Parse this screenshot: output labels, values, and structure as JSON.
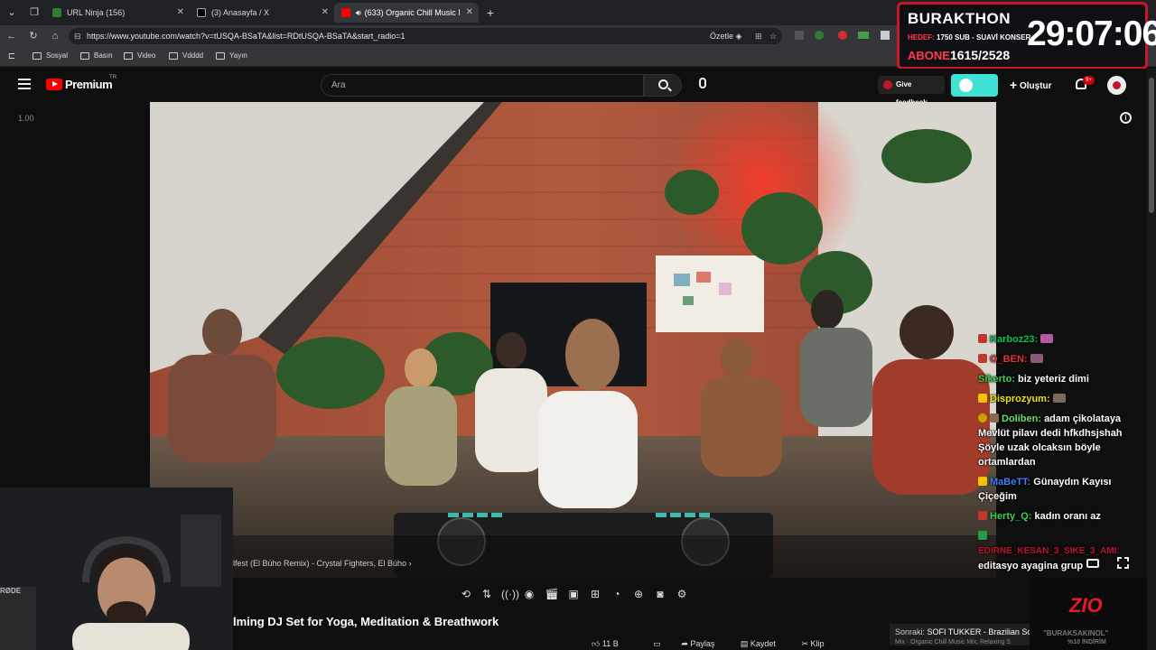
{
  "browser": {
    "tabs": [
      {
        "label": "URL Ninja (156)"
      },
      {
        "label": "(3) Anasayfa / X"
      },
      {
        "label": "(633) Organic Chill Music Mix"
      }
    ],
    "url": "https://www.youtube.com/watch?v=tUSQA-BSaTA&list=RDtUSQA-BSaTA&start_radio=1",
    "summarize_label": "Özetle",
    "bookmarks": [
      "Sosyal",
      "Basın",
      "Video",
      "Vdddd",
      "Yayın"
    ]
  },
  "overlay": {
    "title": "BURAKTHON",
    "hedef_label": "HEDEF:",
    "hedef_text": "1750 SUB - SUAVİ KONSER",
    "abone_label": "ABONE",
    "abone_value": "1615/2528",
    "timer": "29:07:06"
  },
  "youtube": {
    "logo": "Premium",
    "region": "TR",
    "search_placeholder": "Ara",
    "feedback_label": "Give feedback",
    "create_label": "Oluştur",
    "notif_badge": "9+",
    "speed_label": "1.00"
  },
  "video": {
    "song_label": "lfest (El Búho Remix) - Crystal Fighters, El Búho",
    "title": "lming DJ Set for Yoga, Meditation & Breathwork",
    "next_label": "Sonraki:",
    "next_text": "SOFI TUKKER - Brazilian So",
    "next_sub": "Mix · Organic Chill Music Mix, Relaxing S",
    "actions": [
      "11 B",
      "Paylaş",
      "Kaydet",
      "Klip"
    ]
  },
  "chat": [
    {
      "user": "Karboz23:",
      "msg": "",
      "color": "#00c853",
      "badge": "#c0392b"
    },
    {
      "user": "O_BEN:",
      "msg": "",
      "color": "#e53935",
      "badge": "#c0392b"
    },
    {
      "user": "Sikerto:",
      "msg": "biz yeteriz dimi",
      "color": "#39d353",
      "badge": ""
    },
    {
      "user": "Disprozyum:",
      "msg": "",
      "color": "#f2e600",
      "badge": "#f2c200"
    },
    {
      "user": "Doliben:",
      "msg": "adam çikolataya Mevlüt pilavı dedi hfkdhsjshah Şöyle uzak olcaksın böyle ortamlardan",
      "color": "#66e066",
      "badge": "#c7a300"
    },
    {
      "user": "MaBeTT:",
      "msg": "Günaydın Kayısı Çiçeğim",
      "color": "#3d7fff",
      "badge": "#f2c200"
    },
    {
      "user": "Herty_Q:",
      "msg": "kadın oranı az",
      "color": "#39d353",
      "badge": "#c0392b"
    },
    {
      "user": "",
      "msg": "",
      "color": "#39d353",
      "badge": "#1e9e4a"
    },
    {
      "user": "EDIRNE_KESAN_3_SIKE_3_AMI:",
      "msg": "editasyo ayagina grup",
      "color": "#c0152b",
      "badge": ""
    }
  ],
  "brand": {
    "logo_text": "ZIO",
    "promo_name": "\"BURAKSAKINOL\"",
    "promo_text": "%10 İNDİRİM"
  },
  "colors": {
    "accent_red": "#c7182b",
    "youtube_red": "#ff0000",
    "cyan": "#3fe3d6"
  }
}
